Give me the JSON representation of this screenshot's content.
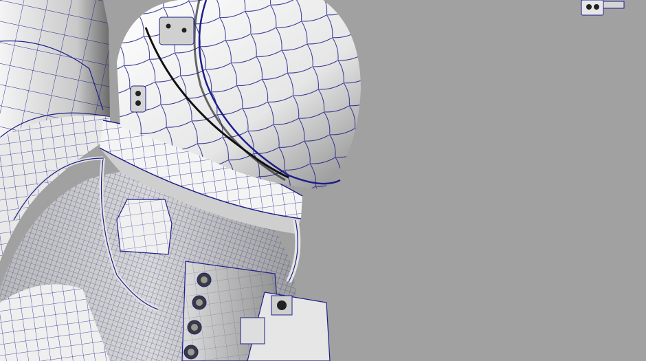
{
  "viewport": {
    "background_color": "#a1a1a1",
    "wire_color": "#1d1f8a",
    "shade_light": "#f2f2f2",
    "shade_dark": "#6e6e6e"
  },
  "scene": {
    "objects": [
      {
        "name": "backpack",
        "icon": "backpack-mesh"
      },
      {
        "name": "helmet",
        "icon": "helmet-mesh"
      },
      {
        "name": "helmet-neck-ring",
        "icon": "ring-mesh"
      },
      {
        "name": "suit-torso",
        "icon": "torso-mesh"
      },
      {
        "name": "chest-control-box",
        "icon": "box-mesh"
      },
      {
        "name": "shoulder-connector",
        "icon": "connector-mesh"
      },
      {
        "name": "hoses",
        "icon": "hose-mesh"
      },
      {
        "name": "floating-part",
        "icon": "small-part-mesh"
      }
    ]
  }
}
